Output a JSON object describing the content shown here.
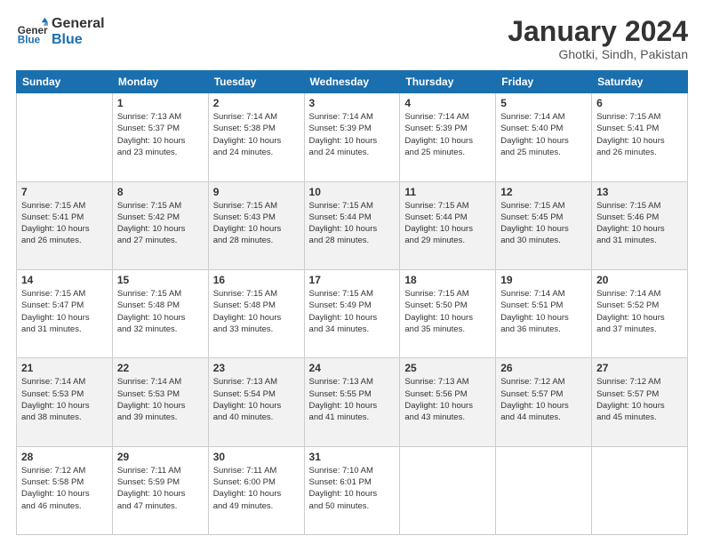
{
  "header": {
    "logo_general": "General",
    "logo_blue": "Blue",
    "main_title": "January 2024",
    "subtitle": "Ghotki, Sindh, Pakistan"
  },
  "calendar": {
    "days_of_week": [
      "Sunday",
      "Monday",
      "Tuesday",
      "Wednesday",
      "Thursday",
      "Friday",
      "Saturday"
    ],
    "weeks": [
      [
        {
          "day": "",
          "content": ""
        },
        {
          "day": "1",
          "content": "Sunrise: 7:13 AM\nSunset: 5:37 PM\nDaylight: 10 hours\nand 23 minutes."
        },
        {
          "day": "2",
          "content": "Sunrise: 7:14 AM\nSunset: 5:38 PM\nDaylight: 10 hours\nand 24 minutes."
        },
        {
          "day": "3",
          "content": "Sunrise: 7:14 AM\nSunset: 5:39 PM\nDaylight: 10 hours\nand 24 minutes."
        },
        {
          "day": "4",
          "content": "Sunrise: 7:14 AM\nSunset: 5:39 PM\nDaylight: 10 hours\nand 25 minutes."
        },
        {
          "day": "5",
          "content": "Sunrise: 7:14 AM\nSunset: 5:40 PM\nDaylight: 10 hours\nand 25 minutes."
        },
        {
          "day": "6",
          "content": "Sunrise: 7:15 AM\nSunset: 5:41 PM\nDaylight: 10 hours\nand 26 minutes."
        }
      ],
      [
        {
          "day": "7",
          "content": "Sunrise: 7:15 AM\nSunset: 5:41 PM\nDaylight: 10 hours\nand 26 minutes."
        },
        {
          "day": "8",
          "content": "Sunrise: 7:15 AM\nSunset: 5:42 PM\nDaylight: 10 hours\nand 27 minutes."
        },
        {
          "day": "9",
          "content": "Sunrise: 7:15 AM\nSunset: 5:43 PM\nDaylight: 10 hours\nand 28 minutes."
        },
        {
          "day": "10",
          "content": "Sunrise: 7:15 AM\nSunset: 5:44 PM\nDaylight: 10 hours\nand 28 minutes."
        },
        {
          "day": "11",
          "content": "Sunrise: 7:15 AM\nSunset: 5:44 PM\nDaylight: 10 hours\nand 29 minutes."
        },
        {
          "day": "12",
          "content": "Sunrise: 7:15 AM\nSunset: 5:45 PM\nDaylight: 10 hours\nand 30 minutes."
        },
        {
          "day": "13",
          "content": "Sunrise: 7:15 AM\nSunset: 5:46 PM\nDaylight: 10 hours\nand 31 minutes."
        }
      ],
      [
        {
          "day": "14",
          "content": "Sunrise: 7:15 AM\nSunset: 5:47 PM\nDaylight: 10 hours\nand 31 minutes."
        },
        {
          "day": "15",
          "content": "Sunrise: 7:15 AM\nSunset: 5:48 PM\nDaylight: 10 hours\nand 32 minutes."
        },
        {
          "day": "16",
          "content": "Sunrise: 7:15 AM\nSunset: 5:48 PM\nDaylight: 10 hours\nand 33 minutes."
        },
        {
          "day": "17",
          "content": "Sunrise: 7:15 AM\nSunset: 5:49 PM\nDaylight: 10 hours\nand 34 minutes."
        },
        {
          "day": "18",
          "content": "Sunrise: 7:15 AM\nSunset: 5:50 PM\nDaylight: 10 hours\nand 35 minutes."
        },
        {
          "day": "19",
          "content": "Sunrise: 7:14 AM\nSunset: 5:51 PM\nDaylight: 10 hours\nand 36 minutes."
        },
        {
          "day": "20",
          "content": "Sunrise: 7:14 AM\nSunset: 5:52 PM\nDaylight: 10 hours\nand 37 minutes."
        }
      ],
      [
        {
          "day": "21",
          "content": "Sunrise: 7:14 AM\nSunset: 5:53 PM\nDaylight: 10 hours\nand 38 minutes."
        },
        {
          "day": "22",
          "content": "Sunrise: 7:14 AM\nSunset: 5:53 PM\nDaylight: 10 hours\nand 39 minutes."
        },
        {
          "day": "23",
          "content": "Sunrise: 7:13 AM\nSunset: 5:54 PM\nDaylight: 10 hours\nand 40 minutes."
        },
        {
          "day": "24",
          "content": "Sunrise: 7:13 AM\nSunset: 5:55 PM\nDaylight: 10 hours\nand 41 minutes."
        },
        {
          "day": "25",
          "content": "Sunrise: 7:13 AM\nSunset: 5:56 PM\nDaylight: 10 hours\nand 43 minutes."
        },
        {
          "day": "26",
          "content": "Sunrise: 7:12 AM\nSunset: 5:57 PM\nDaylight: 10 hours\nand 44 minutes."
        },
        {
          "day": "27",
          "content": "Sunrise: 7:12 AM\nSunset: 5:57 PM\nDaylight: 10 hours\nand 45 minutes."
        }
      ],
      [
        {
          "day": "28",
          "content": "Sunrise: 7:12 AM\nSunset: 5:58 PM\nDaylight: 10 hours\nand 46 minutes."
        },
        {
          "day": "29",
          "content": "Sunrise: 7:11 AM\nSunset: 5:59 PM\nDaylight: 10 hours\nand 47 minutes."
        },
        {
          "day": "30",
          "content": "Sunrise: 7:11 AM\nSunset: 6:00 PM\nDaylight: 10 hours\nand 49 minutes."
        },
        {
          "day": "31",
          "content": "Sunrise: 7:10 AM\nSunset: 6:01 PM\nDaylight: 10 hours\nand 50 minutes."
        },
        {
          "day": "",
          "content": ""
        },
        {
          "day": "",
          "content": ""
        },
        {
          "day": "",
          "content": ""
        }
      ]
    ]
  }
}
